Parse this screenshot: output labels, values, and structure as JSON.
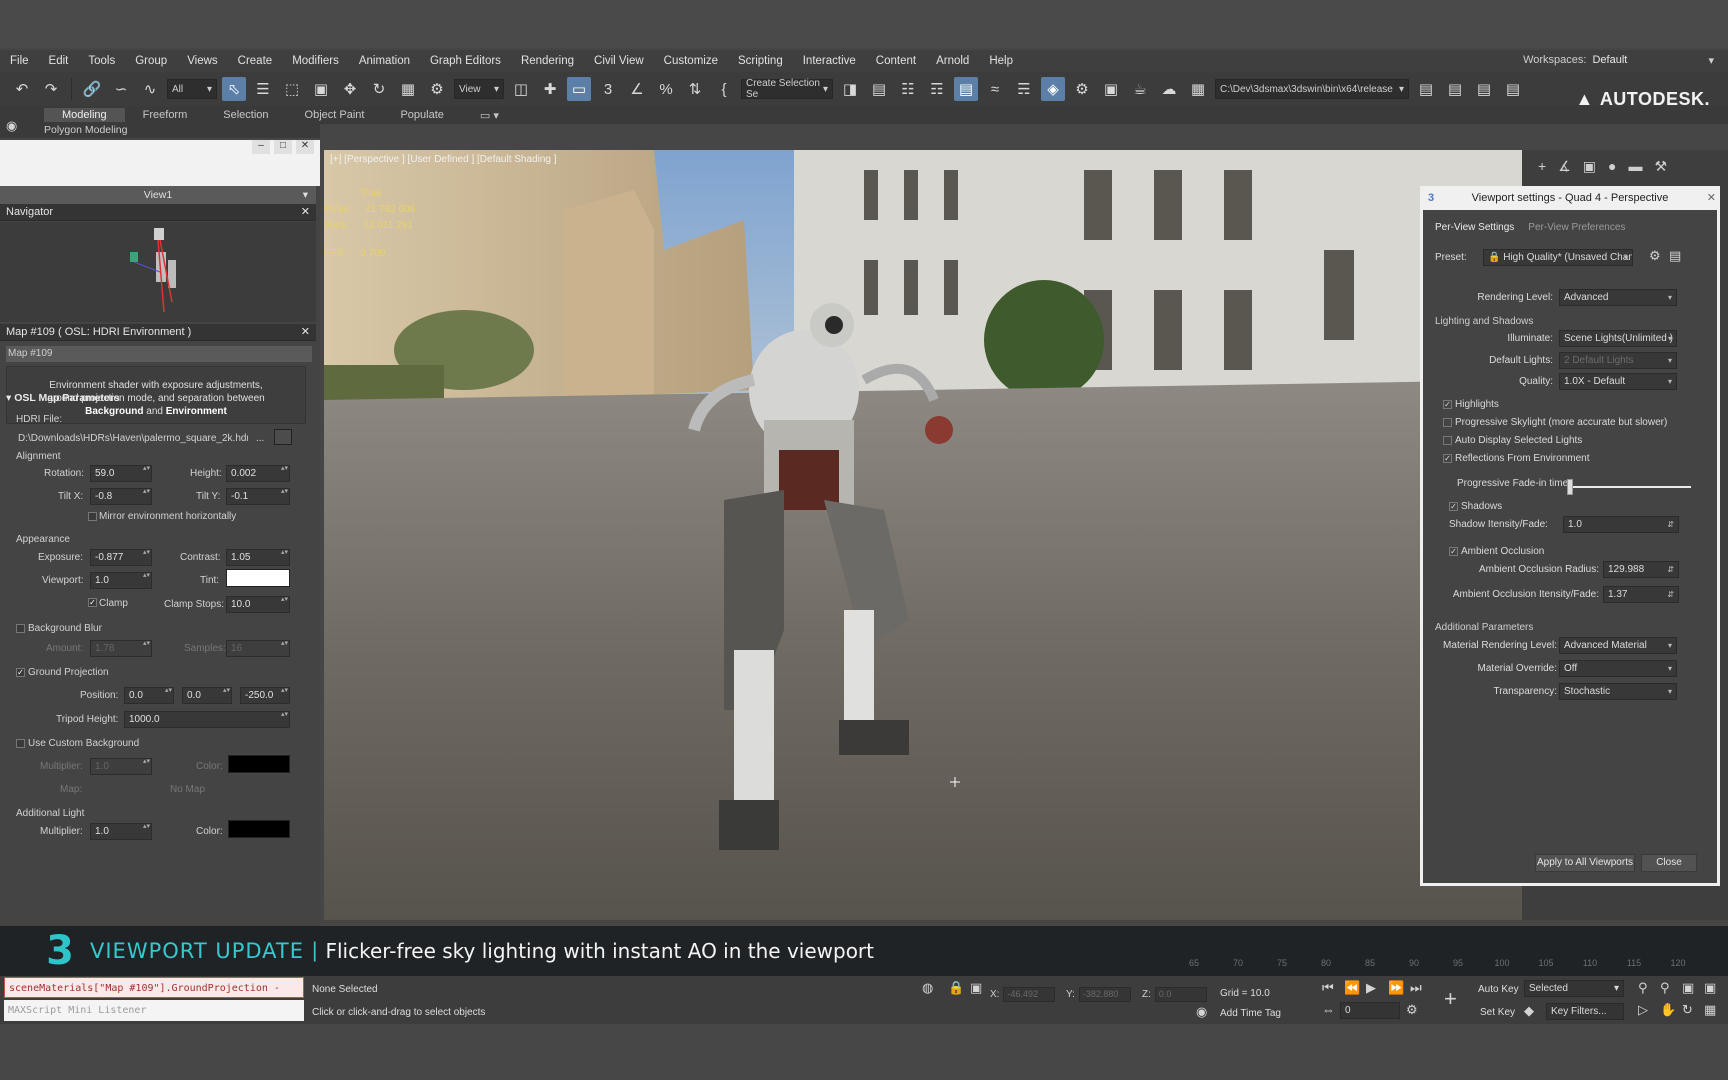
{
  "menu": [
    "File",
    "Edit",
    "Tools",
    "Group",
    "Views",
    "Create",
    "Modifiers",
    "Animation",
    "Graph Editors",
    "Rendering",
    "Civil View",
    "Customize",
    "Scripting",
    "Interactive",
    "Content",
    "Arnold",
    "Help"
  ],
  "workspace": {
    "label": "Workspaces:",
    "value": "Default"
  },
  "toolbar": {
    "filter_value": "All",
    "view_value": "View",
    "selection_set": "Create Selection Se",
    "project_path": "C:\\Dev\\3dsmax\\3dswin\\bin\\x64\\release",
    "brand": "AUTODESK."
  },
  "ribbon": {
    "tabs": [
      "Modeling",
      "Freeform",
      "Selection",
      "Object Paint",
      "Populate"
    ],
    "sub": "Polygon Modeling"
  },
  "left_panel": {
    "view_dropdown": "View1",
    "navigator_title": "Navigator",
    "map_title": "Map #109 ( OSL: HDRI Environment )",
    "map_name": "Map #109",
    "description_line1": "Environment shader with exposure adjustments,",
    "description_line2": "ground projection mode, and separation between",
    "description_bold1": "Background",
    "description_and": "and",
    "description_bold2": "Environment",
    "rollout": "OSL Map Parameters",
    "hdri_label": "HDRI File:",
    "hdri_path": "D:\\Downloads\\HDRs\\Haven\\palermo_square_2k.hdr",
    "hdri_browse": "...",
    "alignment": "Alignment",
    "rotation_label": "Rotation:",
    "rotation": "59.0",
    "height_label": "Height:",
    "height": "0.002",
    "tiltx_label": "Tilt X:",
    "tiltx": "-0.8",
    "tilty_label": "Tilt Y:",
    "tilty": "-0.1",
    "mirror_label": "Mirror environment horizontally",
    "appearance": "Appearance",
    "exposure_label": "Exposure:",
    "exposure": "-0.877",
    "contrast_label": "Contrast:",
    "contrast": "1.05",
    "viewport_label": "Viewport:",
    "viewport": "1.0",
    "tint_label": "Tint:",
    "clamp_label": "Clamp",
    "clamp_stops_label": "Clamp Stops:",
    "clamp_stops": "10.0",
    "bg_blur_label": "Background Blur",
    "amount_label": "Amount:",
    "amount": "1.78",
    "samples_label": "Samples:",
    "samples": "16",
    "ground_proj_label": "Ground Projection",
    "position_label": "Position:",
    "pos_x": "0.0",
    "pos_y": "0.0",
    "pos_z": "-250.0",
    "tripod_label": "Tripod Height:",
    "tripod": "1000.0",
    "custom_bg_label": "Use Custom Background",
    "multiplier_label": "Multiplier:",
    "bg_multiplier": "1.0",
    "color_label": "Color:",
    "map_label": "Map:",
    "no_map": "No Map",
    "additional_light": "Additional Light",
    "light_multiplier_label": "Multiplier:",
    "light_multiplier": "1.0",
    "light_color_label": "Color:",
    "colors": {
      "tint": "#ffffff",
      "bg_color": "#000000",
      "light_color": "#000000"
    }
  },
  "viewport": {
    "label": "[+] [Perspective ] [User Defined ] [Default Shading ]",
    "stats_total": "Total",
    "polys_label": "Polys:",
    "polys": "21 782 606",
    "verts_label": "Verts:",
    "verts": "12 011 291",
    "fps_label": "FPS:",
    "fps": "9.700"
  },
  "dialog": {
    "title": "Viewport settings - Quad 4 - Perspective",
    "tab_active": "Per-View Settings",
    "tab_inactive": "Per-View Preferences",
    "preset_label": "Preset:",
    "preset_value": "High Quality* (Unsaved Chang",
    "rendering_level_label": "Rendering Level:",
    "rendering_level": "Advanced",
    "lighting_section": "Lighting and Shadows",
    "illuminate_label": "Illuminate:",
    "illuminate": "Scene Lights(Unlimited )",
    "default_lights_label": "Default Lights:",
    "default_lights": "2 Default Lights",
    "quality_label": "Quality:",
    "quality": "1.0X - Default",
    "highlights": "Highlights",
    "progressive_skylight": "Progressive Skylight (more accurate but slower)",
    "auto_display": "Auto Display Selected Lights",
    "reflections": "Reflections From Environment",
    "fade_label": "Progressive Fade-in time:",
    "shadows": "Shadows",
    "shadow_intensity_label": "Shadow Itensity/Fade:",
    "shadow_intensity": "1.0",
    "ao": "Ambient Occlusion",
    "ao_radius_label": "Ambient Occlusion Radius:",
    "ao_radius": "129.988",
    "ao_intensity_label": "Ambient Occlusion Itensity/Fade:",
    "ao_intensity": "1.37",
    "additional_section": "Additional Parameters",
    "material_level_label": "Material Rendering Level:",
    "material_level": "Advanced Material",
    "material_override_label": "Material Override:",
    "material_override": "Off",
    "transparency_label": "Transparency:",
    "transparency": "Stochastic",
    "apply_btn": "Apply to All Viewports",
    "close_btn": "Close",
    "fade_value": 0.0
  },
  "caption": {
    "number": "3",
    "title": "VIEWPORT UPDATE",
    "separator": "|",
    "text": "Flicker-free sky lighting with instant AO in the viewport"
  },
  "timeline_ticks": [
    "65",
    "70",
    "75",
    "80",
    "85",
    "90",
    "95",
    "100",
    "105",
    "110",
    "115",
    "120"
  ],
  "status": {
    "maxscript_line": "sceneMaterials[\"Map #109\"].GroundProjection -",
    "listener": "MAXScript Mini Listener",
    "selection": "None Selected",
    "hint": "Click or click-and-drag to select objects",
    "x_label": "X:",
    "y_label": "Y:",
    "z_label": "Z:",
    "x_value": "-46.492",
    "y_value": "-382.880",
    "z_value": "0.0",
    "grid": "Grid = 10.0",
    "add_time_tag": "Add Time Tag",
    "auto_key": "Auto Key",
    "set_key": "Set Key",
    "selected": "Selected",
    "key_filters": "Key Filters...",
    "frame": "0"
  }
}
